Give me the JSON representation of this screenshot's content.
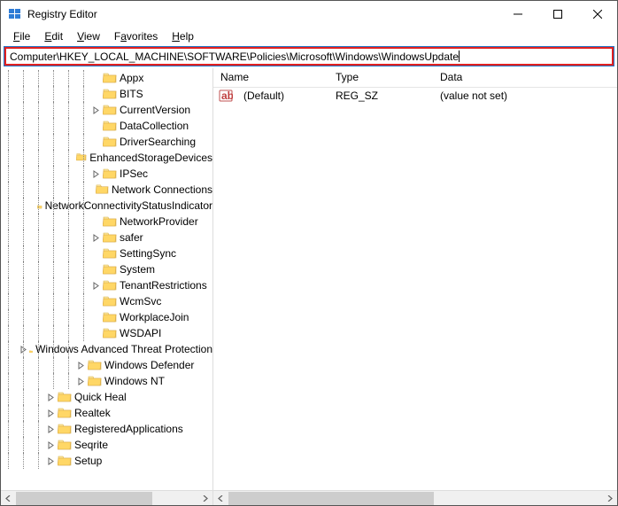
{
  "window": {
    "title": "Registry Editor"
  },
  "menu": {
    "file": "File",
    "edit": "Edit",
    "view": "View",
    "favorites": "Favorites",
    "help": "Help"
  },
  "address": {
    "path": "Computer\\HKEY_LOCAL_MACHINE\\SOFTWARE\\Policies\\Microsoft\\Windows\\WindowsUpdate"
  },
  "tree": {
    "items": [
      {
        "indent": 6,
        "exp": "none",
        "label": "Appx"
      },
      {
        "indent": 6,
        "exp": "none",
        "label": "BITS"
      },
      {
        "indent": 6,
        "exp": "closed",
        "label": "CurrentVersion"
      },
      {
        "indent": 6,
        "exp": "none",
        "label": "DataCollection"
      },
      {
        "indent": 6,
        "exp": "none",
        "label": "DriverSearching"
      },
      {
        "indent": 6,
        "exp": "none",
        "label": "EnhancedStorageDevices"
      },
      {
        "indent": 6,
        "exp": "closed",
        "label": "IPSec"
      },
      {
        "indent": 6,
        "exp": "none",
        "label": "Network Connections"
      },
      {
        "indent": 6,
        "exp": "none",
        "label": "NetworkConnectivityStatusIndicator"
      },
      {
        "indent": 6,
        "exp": "none",
        "label": "NetworkProvider"
      },
      {
        "indent": 6,
        "exp": "closed",
        "label": "safer"
      },
      {
        "indent": 6,
        "exp": "none",
        "label": "SettingSync"
      },
      {
        "indent": 6,
        "exp": "none",
        "label": "System"
      },
      {
        "indent": 6,
        "exp": "closed",
        "label": "TenantRestrictions"
      },
      {
        "indent": 6,
        "exp": "none",
        "label": "WcmSvc"
      },
      {
        "indent": 6,
        "exp": "none",
        "label": "WorkplaceJoin"
      },
      {
        "indent": 6,
        "exp": "none",
        "label": "WSDAPI"
      },
      {
        "indent": 5,
        "exp": "closed",
        "label": "Windows Advanced Threat Protection"
      },
      {
        "indent": 5,
        "exp": "closed",
        "label": "Windows Defender"
      },
      {
        "indent": 5,
        "exp": "closed",
        "label": "Windows NT"
      },
      {
        "indent": 3,
        "exp": "closed",
        "label": "Quick Heal"
      },
      {
        "indent": 3,
        "exp": "closed",
        "label": "Realtek"
      },
      {
        "indent": 3,
        "exp": "closed",
        "label": "RegisteredApplications"
      },
      {
        "indent": 3,
        "exp": "closed",
        "label": "Seqrite"
      },
      {
        "indent": 3,
        "exp": "closed",
        "label": "Setup"
      }
    ]
  },
  "list": {
    "headers": {
      "name": "Name",
      "type": "Type",
      "data": "Data"
    },
    "rows": [
      {
        "name": "(Default)",
        "type": "REG_SZ",
        "data": "(value not set)"
      }
    ]
  }
}
